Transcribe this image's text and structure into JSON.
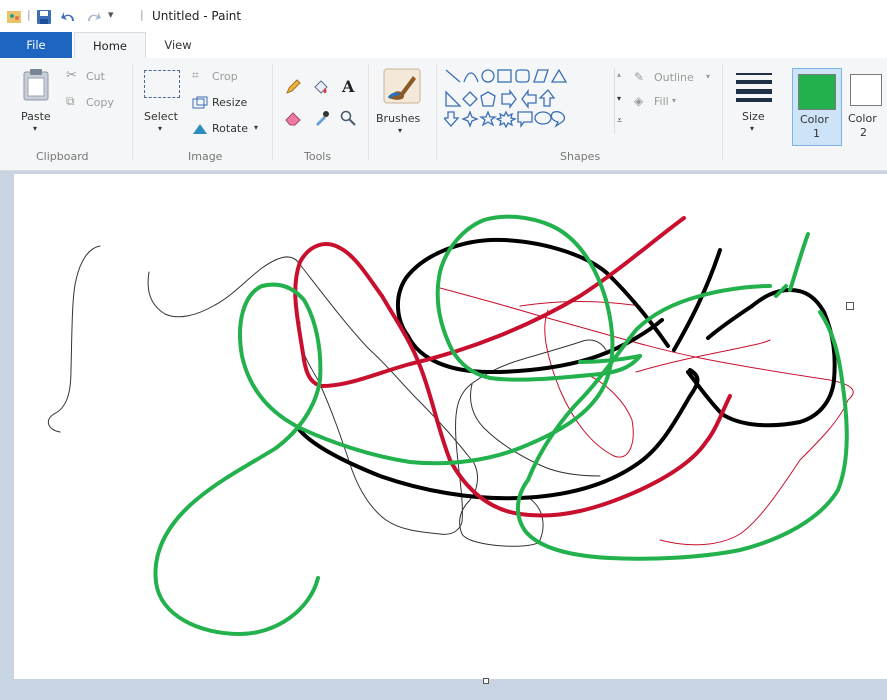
{
  "window": {
    "title": "Untitled - Paint"
  },
  "tabs": {
    "file": "File",
    "home": "Home",
    "view": "View"
  },
  "clipboard": {
    "paste": "Paste",
    "cut": "Cut",
    "copy": "Copy",
    "group": "Clipboard"
  },
  "image": {
    "select": "Select",
    "crop": "Crop",
    "resize": "Resize",
    "rotate": "Rotate",
    "group": "Image"
  },
  "tools": {
    "text_glyph": "A",
    "group": "Tools"
  },
  "brushes": {
    "label": "Brushes"
  },
  "shapes": {
    "outline": "Outline",
    "fill": "Fill",
    "group": "Shapes"
  },
  "size": {
    "label": "Size"
  },
  "colors": {
    "color1_label": "Color",
    "color1_num": "1",
    "color2_label": "Color",
    "color2_num": "2",
    "color1_value": "#22b14c",
    "color2_value": "#ffffff"
  },
  "strokes": {
    "black": "#000000",
    "red": "#c8102e",
    "green": "#22b14c",
    "thin_black": "#333333",
    "thin_red": "#c8102e"
  }
}
